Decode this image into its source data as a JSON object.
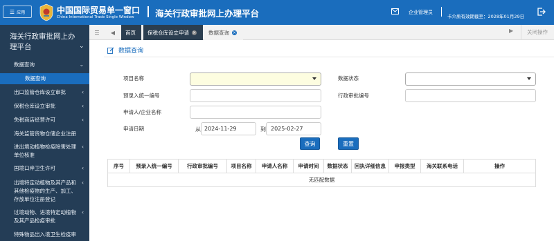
{
  "header": {
    "app_button_label": "应用",
    "brand_cn": "中国国际贸易单一窗口",
    "brand_en": "China International Trade Single Window",
    "page_title": "海关行政审批网上办理平台",
    "user_name": "企业管理员",
    "card_expiry": "卡介质有效期截至：2028年01月29日",
    "colors": {
      "primary": "#1a6dbd",
      "sidebar": "#243d56"
    }
  },
  "sidebar": {
    "title": "海关行政审批网上办理平台",
    "items": [
      {
        "label": "数据查询",
        "arrow": "⌄"
      },
      {
        "label": "数据查询",
        "arrow": ""
      },
      {
        "label": "出口监管仓库设立审批",
        "arrow": "‹"
      },
      {
        "label": "保税仓库设立审批",
        "arrow": "‹"
      },
      {
        "label": "免税商店经营许可",
        "arrow": "‹"
      },
      {
        "label": "海关监管货物仓储企业注册",
        "arrow": ""
      },
      {
        "label": "进出境动植物检疫除害处理单位核准",
        "arrow": "‹"
      },
      {
        "label": "国境口岸卫生许可",
        "arrow": "‹"
      },
      {
        "label": "出境特定动植物及其产品和其他检疫物的生产、加工、存放单位注册登记",
        "arrow": "‹"
      },
      {
        "label": "过境动物、进境特定动植物及其产品检疫审批",
        "arrow": "‹"
      },
      {
        "label": "特殊物品出入境卫生检疫审",
        "arrow": ""
      }
    ]
  },
  "tabs": {
    "home": "首页",
    "tab1": "保税仓库设立申请",
    "tab2": "数据查询",
    "close_ops": "关闭操作"
  },
  "main": {
    "section_title": "数据查询",
    "form": {
      "project_name_label": "项目名称",
      "data_status_label": "数据状态",
      "pre_entry_label": "预录入统一编号",
      "approval_no_label": "行政审批编号",
      "applicant_label": "申请人/企业名称",
      "apply_date_label": "申请日期",
      "from_label": "从",
      "to_label": "到",
      "date_from": "2024-11-29",
      "date_to": "2025-02-27"
    },
    "buttons": {
      "query": "查询",
      "reset": "重置"
    },
    "table": {
      "columns": [
        "序号",
        "预录入统一编号",
        "行政审批编号",
        "项目名称",
        "申请人名称",
        "申请时间",
        "数据状态",
        "回执详细信息",
        "申报类型",
        "海关联系电话",
        "操作"
      ],
      "empty_text": "无匹配数据"
    }
  }
}
